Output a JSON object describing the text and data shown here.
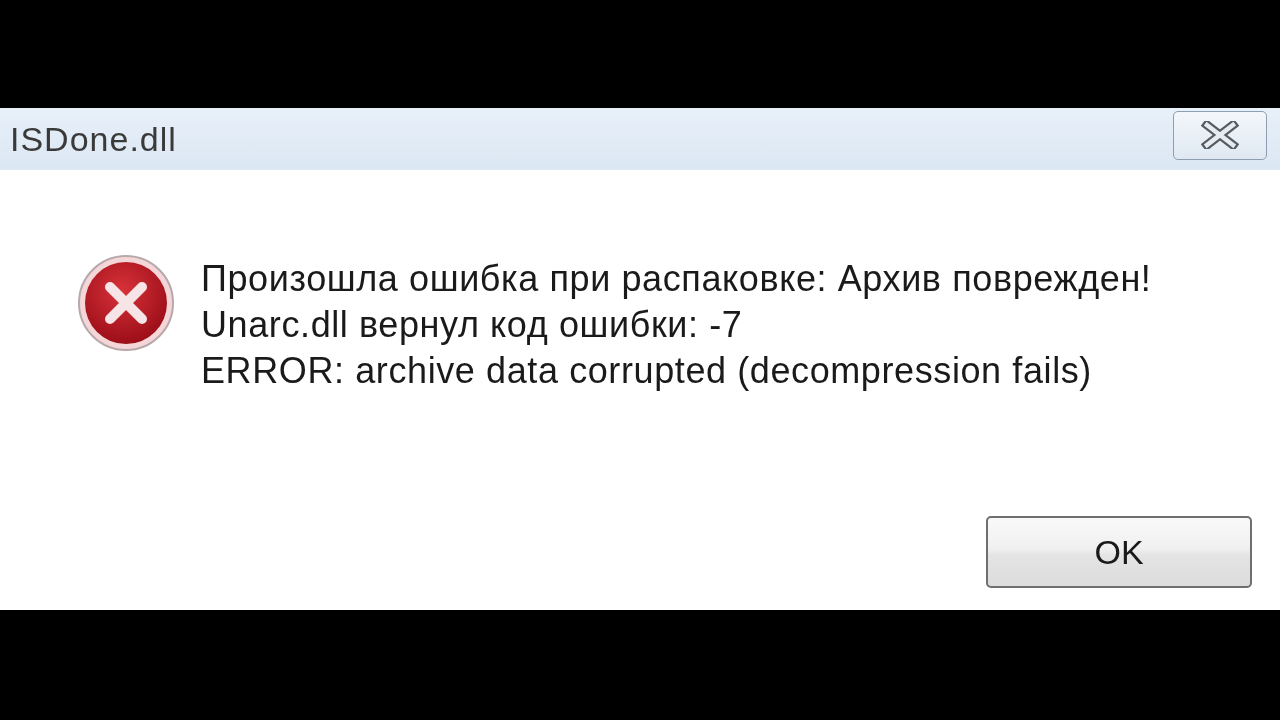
{
  "window": {
    "title": "ISDone.dll"
  },
  "message": {
    "lines": [
      "Произошла ошибка при распаковке: Архив поврежден!",
      "Unarc.dll вернул код ошибки: -7",
      "ERROR: archive data corrupted (decompression fails)"
    ]
  },
  "buttons": [
    {
      "label": "OK"
    }
  ]
}
